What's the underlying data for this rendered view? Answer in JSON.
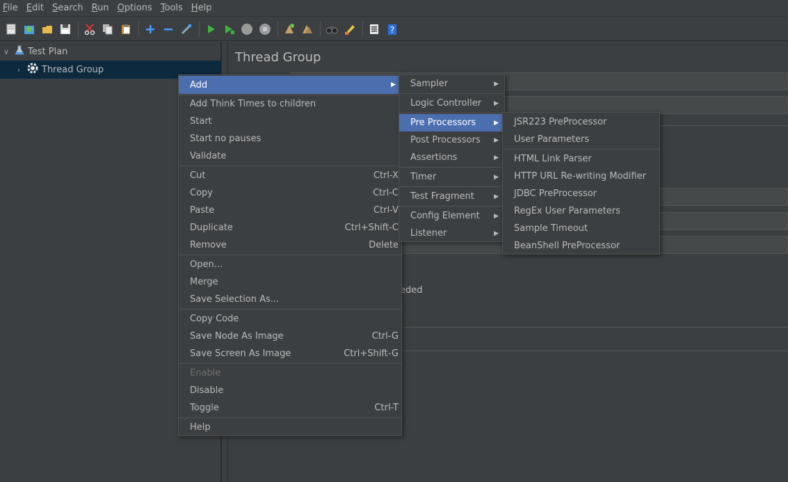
{
  "menubar": {
    "items": [
      {
        "mnemonic": "F",
        "rest": "ile"
      },
      {
        "mnemonic": "E",
        "rest": "dit"
      },
      {
        "mnemonic": "S",
        "rest": "earch"
      },
      {
        "mnemonic": "R",
        "rest": "un"
      },
      {
        "mnemonic": "O",
        "rest": "ptions"
      },
      {
        "mnemonic": "T",
        "rest": "ools"
      },
      {
        "mnemonic": "H",
        "rest": "elp"
      }
    ]
  },
  "toolbar": {
    "icons": [
      "new-icon",
      "templates-icon",
      "open-icon",
      "save-icon",
      "cut-icon",
      "copy-icon",
      "paste-icon",
      "expand-icon",
      "collapse-icon",
      "toggle-icon",
      "start-icon",
      "start-no-pauses-icon",
      "stop-icon",
      "shutdown-icon",
      "clear-icon",
      "clear-all-icon",
      "search-icon",
      "reset-search-icon",
      "function-helper-icon",
      "help-icon"
    ]
  },
  "tree": {
    "test_plan": "Test Plan",
    "thread_group": "Thread Group"
  },
  "panel": {
    "title": "Thread Group",
    "partial_text": "eded"
  },
  "context_menu": {
    "add": "Add",
    "add_think_times": "Add Think Times to children",
    "start": "Start",
    "start_no_pauses": "Start no pauses",
    "validate": "Validate",
    "cut": "Cut",
    "cut_sc": "Ctrl-X",
    "copy": "Copy",
    "copy_sc": "Ctrl-C",
    "paste": "Paste",
    "paste_sc": "Ctrl-V",
    "duplicate": "Duplicate",
    "duplicate_sc": "Ctrl+Shift-C",
    "remove": "Remove",
    "remove_sc": "Delete",
    "open": "Open...",
    "merge": "Merge",
    "save_selection": "Save Selection As...",
    "copy_code": "Copy Code",
    "save_node_image": "Save Node As Image",
    "save_node_image_sc": "Ctrl-G",
    "save_screen_image": "Save Screen As Image",
    "save_screen_image_sc": "Ctrl+Shift-G",
    "enable": "Enable",
    "disable": "Disable",
    "toggle": "Toggle",
    "toggle_sc": "Ctrl-T",
    "help": "Help"
  },
  "add_submenu": {
    "sampler": "Sampler",
    "logic_controller": "Logic Controller",
    "pre_processors": "Pre Processors",
    "post_processors": "Post Processors",
    "assertions": "Assertions",
    "timer": "Timer",
    "test_fragment": "Test Fragment",
    "config_element": "Config Element",
    "listener": "Listener"
  },
  "preprocessors_submenu": {
    "jsr223": "JSR223 PreProcessor",
    "user_parameters": "User Parameters",
    "html_link_parser": "HTML Link Parser",
    "http_url_rewriting": "HTTP URL Re-writing Modifier",
    "jdbc": "JDBC PreProcessor",
    "regex_user_params": "RegEx User Parameters",
    "sample_timeout": "Sample Timeout",
    "beanshell": "BeanShell PreProcessor"
  },
  "colors": {
    "background": "#3c3f41",
    "selection": "#4b6eaf",
    "tree_selection": "#0d293e",
    "text": "#bbbbbb"
  }
}
